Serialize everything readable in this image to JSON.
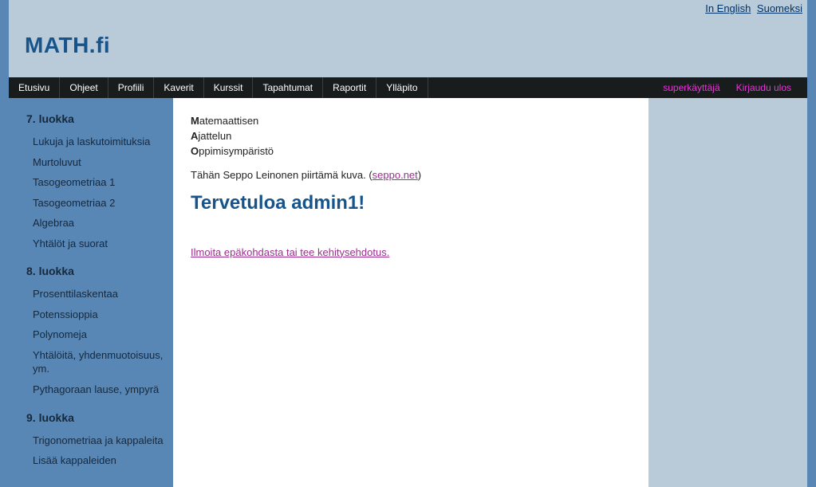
{
  "lang": {
    "english": "In English",
    "suomeksi": "Suomeksi"
  },
  "logo": "MATH.fi",
  "nav": {
    "items": [
      "Etusivu",
      "Ohjeet",
      "Profiili",
      "Kaverit",
      "Kurssit",
      "Tapahtumat",
      "Raportit",
      "Ylläpito"
    ],
    "user": "superkäyttäjä",
    "logout": "Kirjaudu ulos"
  },
  "sidebar": {
    "groups": [
      {
        "heading": "7. luokka",
        "items": [
          "Lukuja ja laskutoimituksia",
          "Murtoluvut",
          "Tasogeometriaa 1",
          "Tasogeometriaa 2",
          "Algebraa",
          "Yhtälöt ja suorat"
        ]
      },
      {
        "heading": "8. luokka",
        "items": [
          "Prosenttilaskentaa",
          "Potenssioppia",
          "Polynomeja",
          "Yhtälöitä, yhdenmuotoisuus, ym.",
          "Pythagoraan lause, ympyrä"
        ]
      },
      {
        "heading": "9. luokka",
        "items": [
          "Trigonometriaa ja kappaleita",
          "Lisää kappaleiden"
        ]
      }
    ]
  },
  "main": {
    "tag1a": "M",
    "tag1b": "atemaattisen",
    "tag2a": "A",
    "tag2b": "jattelun",
    "tag3a": "O",
    "tag3b": "ppimisympäristö",
    "desc_pre": "Tähän Seppo Leinonen piirtämä kuva. (",
    "desc_link": "seppo.net",
    "desc_post": ")",
    "welcome": "Tervetuloa admin1!",
    "feedback": "Ilmoita epäkohdasta tai tee kehitysehdotus."
  }
}
